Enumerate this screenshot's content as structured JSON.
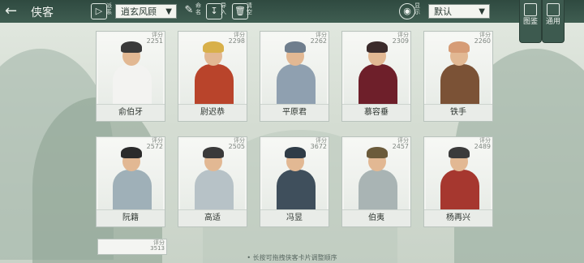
{
  "topbar": {
    "title": "侠客",
    "faction_icon_label": "派系",
    "faction_select": "逍玄风顾",
    "tool_buttons": [
      {
        "name": "edit",
        "label": "命名"
      },
      {
        "name": "import",
        "label": "导入"
      },
      {
        "name": "clear",
        "label": "清空"
      },
      {
        "name": "visibility",
        "label": "显示"
      }
    ],
    "sort_select": "默认"
  },
  "side_tabs": [
    {
      "label": "图鉴"
    },
    {
      "label": "通用"
    }
  ],
  "card_score_label": "评分",
  "cards_row1": [
    {
      "name": "俞伯牙",
      "score": "2251",
      "colors": [
        "#f3f3f1",
        "#3a3a3a"
      ]
    },
    {
      "name": "尉迟恭",
      "score": "2298",
      "colors": [
        "#b9442b",
        "#d8b04a"
      ]
    },
    {
      "name": "平原君",
      "score": "2262",
      "colors": [
        "#8fa0b0",
        "#6f7e8d"
      ]
    },
    {
      "name": "慕容垂",
      "score": "2309",
      "colors": [
        "#6e1f2a",
        "#3b2b2b"
      ]
    },
    {
      "name": "铁手",
      "score": "2260",
      "colors": [
        "#7b5236",
        "#d69c76"
      ]
    }
  ],
  "cards_row2": [
    {
      "name": "阮籍",
      "score": "2572",
      "colors": [
        "#9fb0b8",
        "#2b2b2b"
      ]
    },
    {
      "name": "高适",
      "score": "2505",
      "colors": [
        "#b7c2c7",
        "#3a3a3a"
      ]
    },
    {
      "name": "冯昱",
      "score": "3672",
      "colors": [
        "#3f4f5c",
        "#2f3c47"
      ]
    },
    {
      "name": "伯夷",
      "score": "2457",
      "colors": [
        "#a9b4b4",
        "#6b5b3b"
      ]
    },
    {
      "name": "杨再兴",
      "score": "2489",
      "colors": [
        "#a6372f",
        "#3b3b3b"
      ]
    }
  ],
  "partial_card_score": "3513",
  "footer_hint": "• 长按可拖拽侠客卡片调整顺序"
}
